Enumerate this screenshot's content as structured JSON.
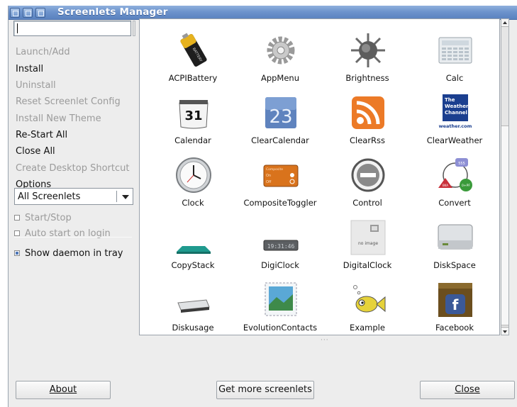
{
  "window": {
    "title": "Screenlets Manager"
  },
  "search": {
    "value": ""
  },
  "menu": [
    {
      "label": "Launch/Add",
      "enabled": false
    },
    {
      "label": "Install",
      "enabled": true
    },
    {
      "label": "Uninstall",
      "enabled": false
    },
    {
      "label": "Reset Screenlet Config",
      "enabled": false
    },
    {
      "label": "Install New Theme",
      "enabled": false
    },
    {
      "label": "Re-Start All",
      "enabled": true
    },
    {
      "label": "Close All",
      "enabled": true
    },
    {
      "label": "Create Desktop Shortcut",
      "enabled": false
    },
    {
      "label": "Options",
      "enabled": true
    }
  ],
  "filter": {
    "selected": "All Screenlets"
  },
  "checks": [
    {
      "label": "Start/Stop",
      "checked": false,
      "enabled": false
    },
    {
      "label": "Auto start on login",
      "checked": false,
      "enabled": false
    },
    {
      "label": "Show daemon in tray",
      "checked": true,
      "enabled": true
    }
  ],
  "screenlets": [
    {
      "name": "ACPIBattery",
      "icon": "battery-icon"
    },
    {
      "name": "AppMenu",
      "icon": "gear-icon"
    },
    {
      "name": "Brightness",
      "icon": "sun-icon"
    },
    {
      "name": "Calc",
      "icon": "calculator-icon"
    },
    {
      "name": "Calendar",
      "icon": "calendar-icon"
    },
    {
      "name": "ClearCalendar",
      "icon": "clear-calendar-icon"
    },
    {
      "name": "ClearRss",
      "icon": "rss-icon"
    },
    {
      "name": "ClearWeather",
      "icon": "weather-channel-icon"
    },
    {
      "name": "Clock",
      "icon": "clock-icon"
    },
    {
      "name": "CompositeToggler",
      "icon": "toggle-icon"
    },
    {
      "name": "Control",
      "icon": "stop-icon"
    },
    {
      "name": "Convert",
      "icon": "convert-icon"
    },
    {
      "name": "CopyStack",
      "icon": "stack-icon"
    },
    {
      "name": "DigiClock",
      "icon": "digital-display-icon"
    },
    {
      "name": "DigitalClock",
      "icon": "no-image-icon"
    },
    {
      "name": "DiskSpace",
      "icon": "hard-drive-icon"
    },
    {
      "name": "Diskusage",
      "icon": "disk-icon"
    },
    {
      "name": "EvolutionContacts",
      "icon": "postage-stamp-icon"
    },
    {
      "name": "Example",
      "icon": "fish-icon"
    },
    {
      "name": "Facebook",
      "icon": "facebook-icon"
    }
  ],
  "icon_text": {
    "calendar_day": "31",
    "clear_calendar_day": "23",
    "weather_lines": [
      "The",
      "Weather",
      "Channel"
    ],
    "weather_url": "weather.com",
    "toggler_title": "Composite",
    "toggler_on": "On",
    "toggler_off": "Off",
    "digi_time": "19:31:46",
    "no_image": "no image",
    "convert_top": "555",
    "convert_left": "BKA",
    "convert_right": "0+PF",
    "battery_text": "BATTERY",
    "facebook_letter": "f"
  },
  "buttons": {
    "about": "About",
    "more": "Get more screenlets",
    "close": "Close"
  },
  "colors": {
    "titlebar": "#6d93cc",
    "accent": "#4f78b9"
  }
}
